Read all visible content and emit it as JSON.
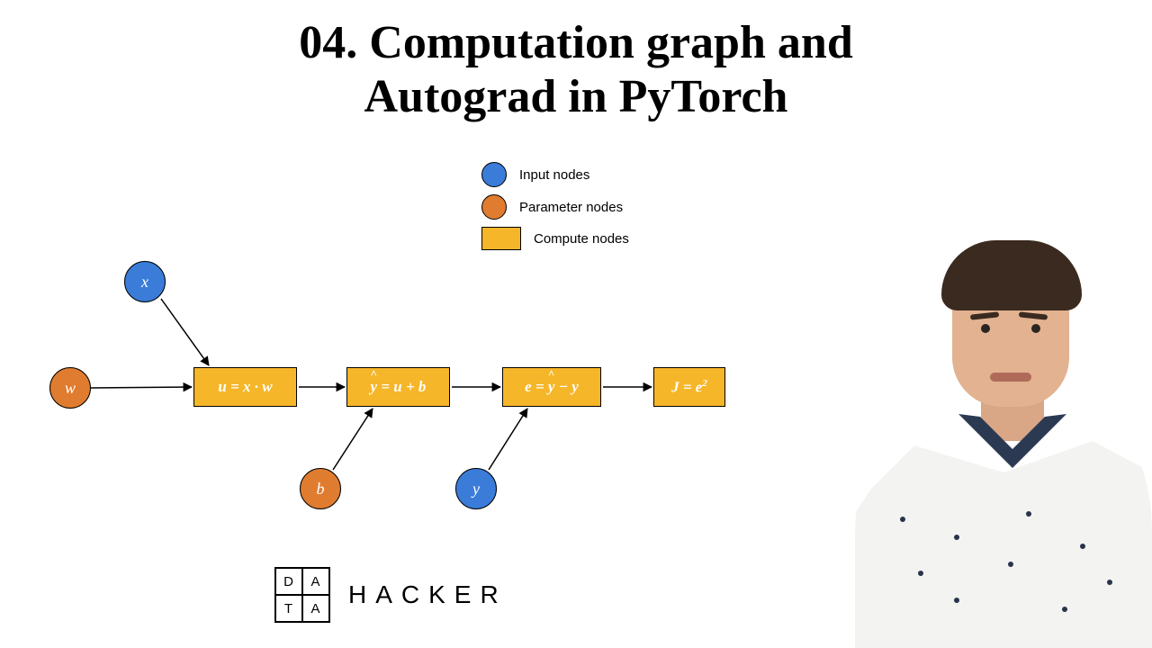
{
  "title_line1": "04. Computation graph and",
  "title_line2": "Autograd in PyTorch",
  "colors": {
    "input": "#3a7cd8",
    "param": "#e07c2f",
    "compute": "#f6b629"
  },
  "legend": {
    "input": "Input nodes",
    "param": "Parameter nodes",
    "compute": "Compute nodes"
  },
  "nodes": {
    "x": "x",
    "w": "w",
    "b": "b",
    "y": "y"
  },
  "boxes": {
    "u": "u = x · w",
    "yhat_left": "y",
    "yhat_right": " = u + b",
    "e_left": "e = ",
    "e_mid": "y",
    "e_right": " − y",
    "J": "J = e",
    "J_sup": "2"
  },
  "logo": {
    "c1": "D",
    "c2": "A",
    "c3": "T",
    "c4": "A",
    "word": "HACKER"
  }
}
